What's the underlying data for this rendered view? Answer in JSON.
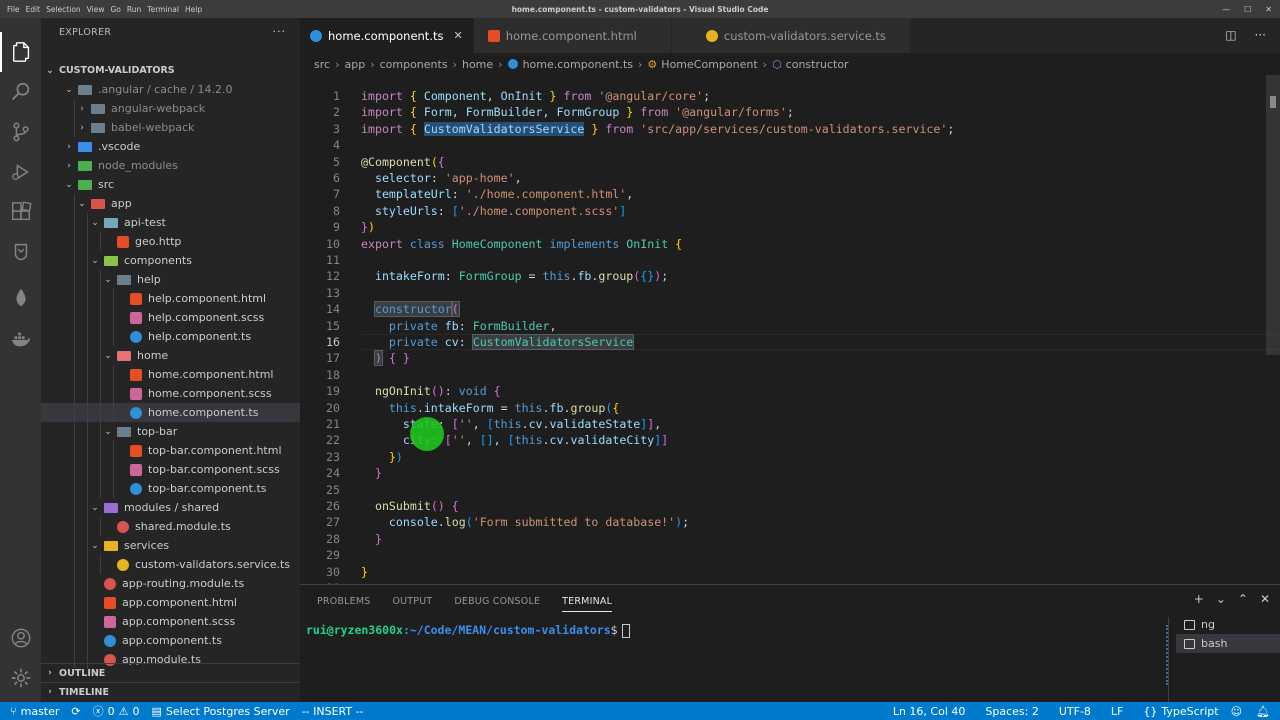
{
  "window": {
    "title": "home.component.ts - custom-validators - Visual Studio Code",
    "menu": [
      "File",
      "Edit",
      "Selection",
      "View",
      "Go",
      "Run",
      "Terminal",
      "Help"
    ]
  },
  "sidebar": {
    "header": "EXPLORER",
    "more": "···",
    "root": "CUSTOM-VALIDATORS",
    "tree": [
      {
        "label": ".angular / cache / 14.2.0",
        "type": "folder",
        "expanded": true,
        "depth": 1,
        "dim": true
      },
      {
        "label": "angular-webpack",
        "type": "folder",
        "expanded": false,
        "depth": 2,
        "dim": true
      },
      {
        "label": "babel-webpack",
        "type": "folder",
        "expanded": false,
        "depth": 2,
        "dim": true
      },
      {
        "label": ".vscode",
        "type": "folder",
        "expanded": false,
        "depth": 1
      },
      {
        "label": "node_modules",
        "type": "folder",
        "expanded": false,
        "depth": 1,
        "dim": true
      },
      {
        "label": "src",
        "type": "folder",
        "expanded": true,
        "depth": 1
      },
      {
        "label": "app",
        "type": "folder",
        "expanded": true,
        "depth": 2
      },
      {
        "label": "api-test",
        "type": "folder",
        "expanded": true,
        "depth": 3
      },
      {
        "label": "geo.http",
        "type": "file",
        "depth": 4
      },
      {
        "label": "components",
        "type": "folder",
        "expanded": true,
        "depth": 3
      },
      {
        "label": "help",
        "type": "folder",
        "expanded": true,
        "depth": 4
      },
      {
        "label": "help.component.html",
        "type": "file",
        "depth": 5
      },
      {
        "label": "help.component.scss",
        "type": "file",
        "depth": 5
      },
      {
        "label": "help.component.ts",
        "type": "file",
        "depth": 5
      },
      {
        "label": "home",
        "type": "folder",
        "expanded": true,
        "depth": 4
      },
      {
        "label": "home.component.html",
        "type": "file",
        "depth": 5
      },
      {
        "label": "home.component.scss",
        "type": "file",
        "depth": 5
      },
      {
        "label": "home.component.ts",
        "type": "file",
        "depth": 5,
        "selected": true
      },
      {
        "label": "top-bar",
        "type": "folder",
        "expanded": true,
        "depth": 4
      },
      {
        "label": "top-bar.component.html",
        "type": "file",
        "depth": 5
      },
      {
        "label": "top-bar.component.scss",
        "type": "file",
        "depth": 5
      },
      {
        "label": "top-bar.component.ts",
        "type": "file",
        "depth": 5
      },
      {
        "label": "modules / shared",
        "type": "folder",
        "expanded": true,
        "depth": 3
      },
      {
        "label": "shared.module.ts",
        "type": "file",
        "depth": 4
      },
      {
        "label": "services",
        "type": "folder",
        "expanded": true,
        "depth": 3
      },
      {
        "label": "custom-validators.service.ts",
        "type": "file",
        "depth": 4
      },
      {
        "label": "app-routing.module.ts",
        "type": "file",
        "depth": 3
      },
      {
        "label": "app.component.html",
        "type": "file",
        "depth": 3
      },
      {
        "label": "app.component.scss",
        "type": "file",
        "depth": 3
      },
      {
        "label": "app.component.ts",
        "type": "file",
        "depth": 3
      },
      {
        "label": "app.module.ts",
        "type": "file",
        "depth": 3
      }
    ],
    "outline": "OUTLINE",
    "timeline": "TIMELINE"
  },
  "tabs": [
    {
      "label": "home.component.ts",
      "active": true,
      "close": "✕"
    },
    {
      "label": "home.component.html",
      "active": false
    },
    {
      "label": "custom-validators.service.ts",
      "active": false
    }
  ],
  "breadcrumb": [
    "src",
    "app",
    "components",
    "home",
    "home.component.ts",
    "HomeComponent",
    "constructor"
  ],
  "editor": {
    "current_line": 16,
    "lines": [
      {
        "n": 1,
        "html": "<span class='ctl'>import</span> <span class='br1'>{</span> <span class='var'>Component</span>, <span class='var'>OnInit</span> <span class='br1'>}</span> <span class='ctl'>from</span> <span class='str'>'@angular/core'</span>;"
      },
      {
        "n": 2,
        "html": "<span class='ctl'>import</span> <span class='br1'>{</span> <span class='var'>Form</span>, <span class='var'>FormBuilder</span>, <span class='var'>FormGroup</span> <span class='br1'>}</span> <span class='ctl'>from</span> <span class='str'>'@angular/forms'</span>;"
      },
      {
        "n": 3,
        "html": "<span class='ctl'>import</span> <span class='br1'>{</span> <span class='var hl'>CustomValidatorsService</span> <span class='br1'>}</span> <span class='ctl'>from</span> <span class='str'>'src/app/services/custom-validators.service'</span>;"
      },
      {
        "n": 4,
        "html": ""
      },
      {
        "n": 5,
        "html": "<span class='fn'>@Component</span><span class='br1'>(</span><span class='br2'>{</span>"
      },
      {
        "n": 6,
        "html": "  <span class='var'>selector</span>: <span class='str'>'app-home'</span>,"
      },
      {
        "n": 7,
        "html": "  <span class='var'>templateUrl</span>: <span class='str'>'./home.component.html'</span>,"
      },
      {
        "n": 8,
        "html": "  <span class='var'>styleUrls</span>: <span class='br3'>[</span><span class='str'>'./home.component.scss'</span><span class='br3'>]</span>"
      },
      {
        "n": 9,
        "html": "<span class='br2'>}</span><span class='br1'>)</span>"
      },
      {
        "n": 10,
        "html": "<span class='ctl'>export</span> <span class='kw'>class</span> <span class='ty'>HomeComponent</span> <span class='kw'>implements</span> <span class='ty'>OnInit</span> <span class='br1'>{</span>"
      },
      {
        "n": 11,
        "html": ""
      },
      {
        "n": 12,
        "html": "  <span class='var'>intakeForm</span>: <span class='ty'>FormGroup</span> = <span class='kw'>this</span>.<span class='var'>fb</span>.<span class='fn'>group</span><span class='br2'>(</span><span class='br3'>{}</span><span class='br2'>)</span>;"
      },
      {
        "n": 13,
        "html": ""
      },
      {
        "n": 14,
        "html": "  <span class='kw hl2'>constructor</span><span class='br2 hl2'>(</span>"
      },
      {
        "n": 15,
        "html": "    <span class='kw'>private</span> <span class='var'>fb</span>: <span class='ty'>FormBuilder</span>,"
      },
      {
        "n": 16,
        "html": "    <span class='kw'>private</span> <span class='var'>cv</span>: <span class='ty hl2'>CustomValidatorsService</span>"
      },
      {
        "n": 17,
        "html": "  <span class='br2 hl2'>)</span> <span class='br2'>{ }</span>"
      },
      {
        "n": 18,
        "html": ""
      },
      {
        "n": 19,
        "html": "  <span class='fn'>ngOnInit</span><span class='br2'>()</span>: <span class='kw'>void</span> <span class='br2'>{</span>"
      },
      {
        "n": 20,
        "html": "    <span class='kw'>this</span>.<span class='var'>intakeForm</span> = <span class='kw'>this</span>.<span class='var'>fb</span>.<span class='fn'>group</span><span class='br3'>(</span><span class='br1'>{</span>"
      },
      {
        "n": 21,
        "html": "      <span class='var'>state</span>: <span class='br2'>[</span><span class='str'>''</span>, <span class='br3'>[</span><span class='kw'>this</span>.<span class='var'>cv</span>.<span class='var'>validateState</span><span class='br3'>]</span><span class='br2'>]</span>,"
      },
      {
        "n": 22,
        "html": "      <span class='var'>city</span>: <span class='br2'>[</span><span class='str'>''</span>, <span class='br3'>[]</span>, <span class='br3'>[</span><span class='kw'>this</span>.<span class='var'>cv</span>.<span class='var'>validateCity</span><span class='br3'>]</span><span class='br2'>]</span>"
      },
      {
        "n": 23,
        "html": "    <span class='br1'>}</span><span class='br3'>)</span>"
      },
      {
        "n": 24,
        "html": "  <span class='br2'>}</span>"
      },
      {
        "n": 25,
        "html": ""
      },
      {
        "n": 26,
        "html": "  <span class='fn'>onSubmit</span><span class='br2'>()</span> <span class='br2'>{</span>"
      },
      {
        "n": 27,
        "html": "    <span class='var'>console</span>.<span class='fn'>log</span><span class='br3'>(</span><span class='str'>'Form submitted to database!'</span><span class='br3'>)</span>;"
      },
      {
        "n": 28,
        "html": "  <span class='br2'>}</span>"
      },
      {
        "n": 29,
        "html": ""
      },
      {
        "n": 30,
        "html": "<span class='br1'>}</span>"
      },
      {
        "n": 31,
        "html": ""
      }
    ]
  },
  "panel": {
    "tabs": [
      "PROBLEMS",
      "OUTPUT",
      "DEBUG CONSOLE",
      "TERMINAL"
    ],
    "active_tab": "TERMINAL",
    "actions": [
      "+",
      "⌄",
      "⌃",
      "✕"
    ],
    "terminal_prompt": "rui@ryzen3600x",
    "terminal_path": ":~/Code/MEAN/custom-validators",
    "terminal_dollar": "$",
    "terminals": [
      "ng",
      "bash"
    ]
  },
  "statusbar": {
    "branch": "master",
    "errors": "0",
    "warnings": "0",
    "postgres": "Select Postgres Server",
    "mode": "-- INSERT --",
    "position": "Ln 16, Col 40",
    "spaces": "Spaces: 2",
    "encoding": "UTF-8",
    "eol": "LF",
    "language": "TypeScript"
  },
  "colors": {
    "accent": "#007acc",
    "activity_bar": "#333333",
    "sidebar": "#252526",
    "editor": "#1e1e1e"
  }
}
